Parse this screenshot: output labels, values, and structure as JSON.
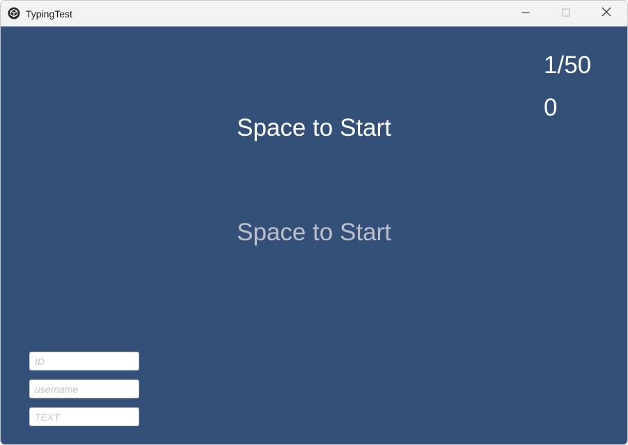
{
  "window": {
    "title": "TypingTest",
    "background_color": "#325078"
  },
  "hud": {
    "progress": "1/50",
    "score": "0"
  },
  "main": {
    "target_text": "Space to Start",
    "typed_text": "Space to Start"
  },
  "form": {
    "id_field": {
      "value": "",
      "placeholder": "ID"
    },
    "username_field": {
      "value": "",
      "placeholder": "username"
    },
    "text_field": {
      "value": "",
      "placeholder": "TEXT"
    }
  },
  "icons": {
    "app": "unity-logo-icon",
    "minimize": "minimize-icon",
    "maximize": "maximize-icon",
    "close": "close-icon"
  }
}
